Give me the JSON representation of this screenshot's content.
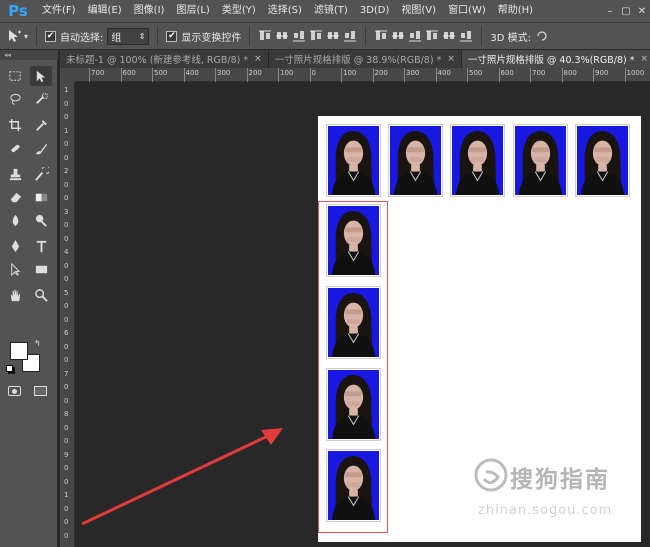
{
  "app": {
    "logo": "Ps"
  },
  "menu": [
    "文件(F)",
    "编辑(E)",
    "图像(I)",
    "图层(L)",
    "类型(Y)",
    "选择(S)",
    "滤镜(T)",
    "3D(D)",
    "视图(V)",
    "窗口(W)",
    "帮助(H)"
  ],
  "options": {
    "auto_select_label": "自动选择:",
    "auto_select_checked": true,
    "auto_select_value": "组",
    "show_transform_label": "显示变换控件",
    "show_transform_checked": true,
    "mode_label": "3D 模式:"
  },
  "tabs": [
    {
      "label": "未标题-1 @ 100% (新建参考线, RGB/8) *",
      "active": false
    },
    {
      "label": "一寸照片规格排版 @ 38.9%(RGB/8) *",
      "active": false
    },
    {
      "label": "一寸照片规格排版 @ 40.3%(RGB/8) *",
      "active": true
    }
  ],
  "ruler_top_labels": [
    "700",
    "600",
    "500",
    "400",
    "300",
    "200",
    "100",
    "0",
    "100",
    "200",
    "300",
    "400",
    "500",
    "600",
    "700",
    "800",
    "900",
    "1000"
  ],
  "ruler_left_labels": [
    "1",
    "0",
    "0",
    "1",
    "0",
    "0",
    "2",
    "0",
    "0",
    "3",
    "0",
    "0",
    "4",
    "0",
    "0",
    "5",
    "0",
    "0",
    "6",
    "0",
    "0",
    "7",
    "0",
    "0",
    "8",
    "0",
    "0",
    "9",
    "0",
    "0",
    "1",
    "0",
    "0",
    "0"
  ],
  "colors": {
    "photo_bg": "#1818e0",
    "selection": "#e05555",
    "arrow": "#e23b3b",
    "panel": "#535353",
    "canvas_bg": "#282828"
  },
  "watermark": {
    "text": "搜狗指南",
    "url": "zhinan.sogou.com"
  }
}
